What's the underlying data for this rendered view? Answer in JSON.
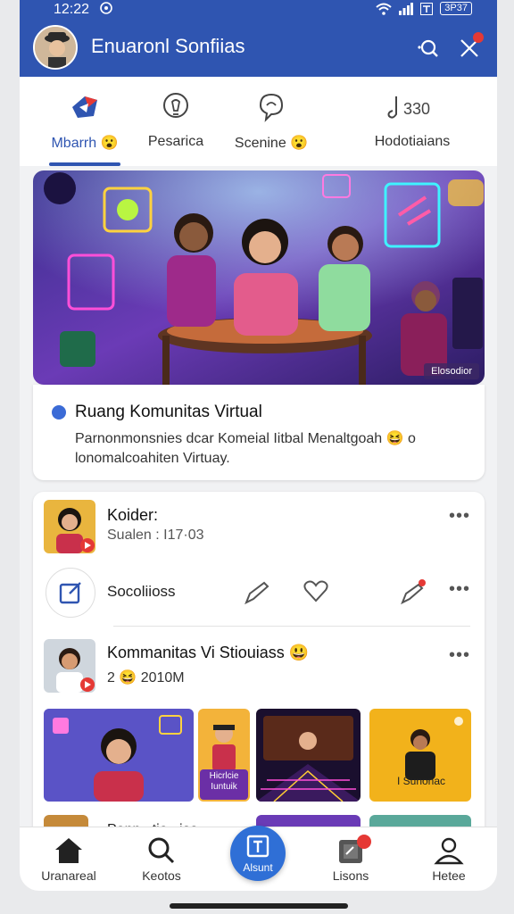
{
  "status": {
    "time": "12:22",
    "battery": "3P37"
  },
  "header": {
    "title": "Enuaronl Sonfiias"
  },
  "tabs": [
    {
      "label": "Mbarrh",
      "icon": "home-arrow-icon",
      "active": true
    },
    {
      "label": "Pesarica",
      "icon": "lightbulb-icon"
    },
    {
      "label": "Scenine",
      "icon": "chat-bubble-icon"
    },
    {
      "label": "Hodotiaians",
      "icon": "music-note-icon",
      "extra": "330"
    }
  ],
  "hero": {
    "badge": "Elosodior"
  },
  "info": {
    "title": "Ruang Komunitas Virtual",
    "description": "Parnonmonsnies dcar Komeial Iitbal Menaltgoah 😆 o lonomalcoahiten Virtuay."
  },
  "feed": {
    "post1": {
      "name": "Koider:",
      "sub": "Sualen : I17·03",
      "more": "•••"
    },
    "actions": {
      "label": "Socoliioss",
      "more": "•••"
    },
    "post2": {
      "name": "Kommanitas Vi Stiouiass 😃",
      "sub": "2 😆 2010M",
      "more": "•••"
    },
    "gallery": [
      {
        "caption": ""
      },
      {
        "caption": "Hicrlcie Iuntuik"
      },
      {
        "caption": ""
      },
      {
        "caption": "I Sunonac"
      }
    ],
    "peek_text": "Ponn...tio...ias"
  },
  "bottom_nav": [
    {
      "label": "Uranareal",
      "icon": "home-icon"
    },
    {
      "label": "Keotos",
      "icon": "search-icon"
    },
    {
      "label": "Alsunt",
      "icon": "plus-box-icon"
    },
    {
      "label": "Lisons",
      "icon": "tablet-icon"
    },
    {
      "label": "Hetee",
      "icon": "profile-icon"
    }
  ],
  "colors": {
    "primary": "#2f55b1",
    "accent": "#2f6fd6",
    "badge": "#e53935"
  }
}
